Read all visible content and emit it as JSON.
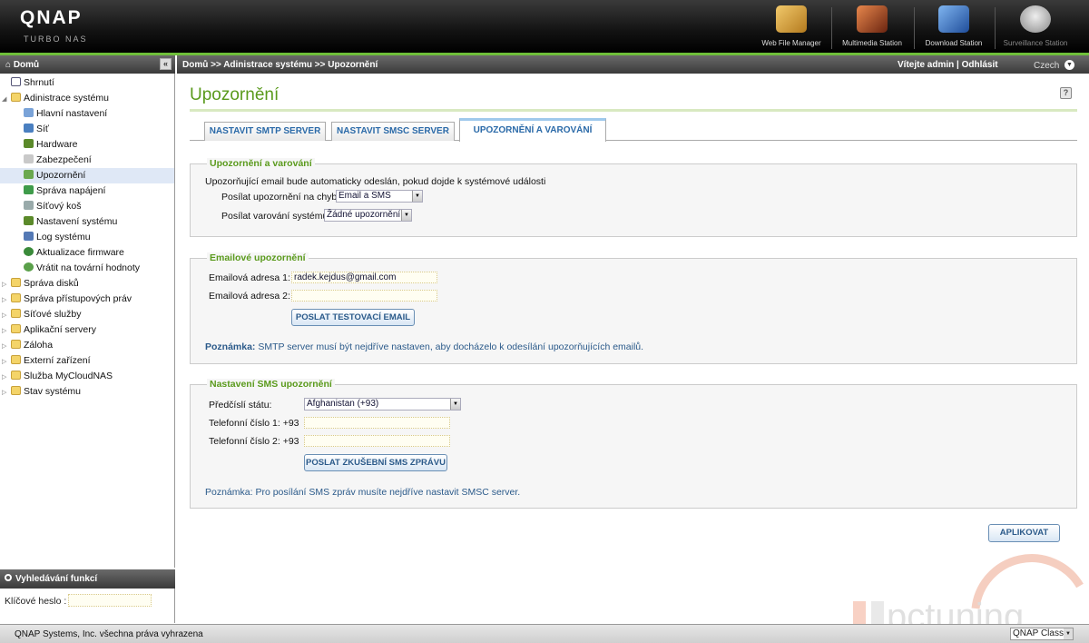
{
  "header": {
    "logo": "QNAP",
    "logo_sub": "TURBO NAS",
    "apps": [
      {
        "label": "Web File Manager",
        "icon": "file-manager-icon",
        "color": "#d9a441"
      },
      {
        "label": "Multimedia Station",
        "icon": "multimedia-icon",
        "color": "#c85a2a"
      },
      {
        "label": "Download Station",
        "icon": "download-icon",
        "color": "#3a7bd5"
      },
      {
        "label": "Surveillance Station",
        "icon": "camera-icon",
        "color": "#bbbbbb"
      }
    ]
  },
  "sidebar": {
    "home_label": "Domů",
    "collapse_label": "«",
    "items": [
      {
        "label": "Shrnutí",
        "icon": "summary-icon"
      },
      {
        "label": "Adinistrace systému",
        "icon": "folder-open-icon"
      },
      {
        "label": "Hlavní nastavení",
        "icon": "settings-icon"
      },
      {
        "label": "Síť",
        "icon": "network-icon"
      },
      {
        "label": "Hardware",
        "icon": "hardware-icon"
      },
      {
        "label": "Zabezpečení",
        "icon": "lock-icon"
      },
      {
        "label": "Upozornění",
        "icon": "bell-icon"
      },
      {
        "label": "Správa napájení",
        "icon": "power-icon"
      },
      {
        "label": "Síťový koš",
        "icon": "recycle-bin-icon"
      },
      {
        "label": "Nastavení systému",
        "icon": "system-settings-icon"
      },
      {
        "label": "Log systému",
        "icon": "log-icon"
      },
      {
        "label": "Aktualizace firmware",
        "icon": "firmware-icon"
      },
      {
        "label": "Vrátit na tovární hodnoty",
        "icon": "restore-icon"
      },
      {
        "label": "Správa disků",
        "icon": "folder-icon"
      },
      {
        "label": "Správa přístupových práv",
        "icon": "folder-icon"
      },
      {
        "label": "Síťové služby",
        "icon": "folder-icon"
      },
      {
        "label": "Aplikační servery",
        "icon": "folder-icon"
      },
      {
        "label": "Záloha",
        "icon": "folder-icon"
      },
      {
        "label": "Externí zařízení",
        "icon": "folder-icon"
      },
      {
        "label": "Služba MyCloudNAS",
        "icon": "folder-icon"
      },
      {
        "label": "Stav systému",
        "icon": "folder-icon"
      }
    ]
  },
  "search": {
    "title": "Vyhledávání funkcí",
    "label": "Klíčové heslo :",
    "value": ""
  },
  "crumbbar": {
    "breadcrumb": "Domů >> Adinistrace systému >> Upozornění",
    "welcome": "Vítejte admin | Odhlásit",
    "language": "Czech"
  },
  "main": {
    "title": "Upozornění",
    "help": "?",
    "tabs": [
      "NASTAVIT SMTP SERVER",
      "NASTAVIT SMSC SERVER",
      "UPOZORNĚNÍ A VAROVÁNÍ"
    ],
    "alerts": {
      "legend": "Upozornění a varování",
      "description": "Upozorňující email bude automaticky odeslán, pokud dojde k systémové události",
      "error_label": "Posílat upozornění na chyby:",
      "error_value": "Email a SMS",
      "warning_label": "Posílat varování systému:",
      "warning_value": "Žádné upozornění"
    },
    "email": {
      "legend": "Emailové upozornění",
      "addr1_label": "Emailová adresa 1:",
      "addr1_value": "radek.kejdus@gmail.com",
      "addr2_label": "Emailová adresa 2:",
      "addr2_value": "",
      "test_button": "POSLAT TESTOVACÍ EMAIL",
      "note_bold": "Poznámka:",
      "note_text": " SMTP server musí být nejdříve nastaven, aby docházelo k odesílání upozorňujících emailů."
    },
    "sms": {
      "legend": "Nastavení SMS upozornění",
      "prefix_label": "Předčíslí státu:",
      "prefix_value": "Afghanistan (+93)",
      "phone1_label": "Telefonní číslo 1: +93",
      "phone1_value": "",
      "phone2_label": "Telefonní číslo 2: +93",
      "phone2_value": "",
      "test_button": "POSLAT ZKUŠEBNÍ SMS ZPRÁVU",
      "note": "Poznámka: Pro posílání SMS zpráv musíte nejdříve nastavit SMSC server."
    },
    "apply_button": "APLIKOVAT"
  },
  "footer": {
    "copyright": "QNAP Systems, Inc. všechna práva vyhrazena",
    "skin": "QNAP Classic"
  },
  "colors": {
    "accent_green": "#5a9a1c",
    "link_blue": "#2b6aa8",
    "header_dark": "#121212"
  }
}
